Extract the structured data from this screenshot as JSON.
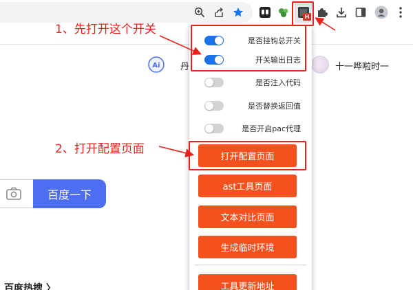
{
  "toolbar": {
    "icons": [
      "zoom-icon",
      "share-icon",
      "bookmark-star-icon",
      "ext-dark-icon",
      "ext-puzzle-green-icon",
      "ext-active-icon",
      "extensions-puzzle-icon",
      "download-icon",
      "side-panel-icon",
      "profile-icon",
      "kebab-menu-icon"
    ],
    "active_extension_badge": "H",
    "accent_star_color": "#1a73e8"
  },
  "page": {
    "ai_text": "丹",
    "username": "十一哗啦时一",
    "search_button": "百度一下",
    "hot_search_label": "百度热搜 〉"
  },
  "popup": {
    "toggles": [
      {
        "label": "是否挂钩总开关",
        "on": true
      },
      {
        "label": "开关输出日志",
        "on": true
      },
      {
        "label": "是否注入代码",
        "on": false
      },
      {
        "label": "是否替换返回值",
        "on": false
      },
      {
        "label": "是否开启pac代理",
        "on": false
      }
    ],
    "buttons": [
      {
        "label": "打开配置页面"
      },
      {
        "label": "ast工具页面"
      },
      {
        "label": "文本对比页面"
      },
      {
        "label": "生成临时环境"
      },
      {
        "label": "工具更新地址"
      }
    ],
    "button_color": "#f4511e",
    "toggle_on_color": "#1a73e8"
  },
  "annotations": {
    "step1": "1、先打开这个开关",
    "step2": "2、打开配置页面",
    "color": "#e8221b"
  }
}
